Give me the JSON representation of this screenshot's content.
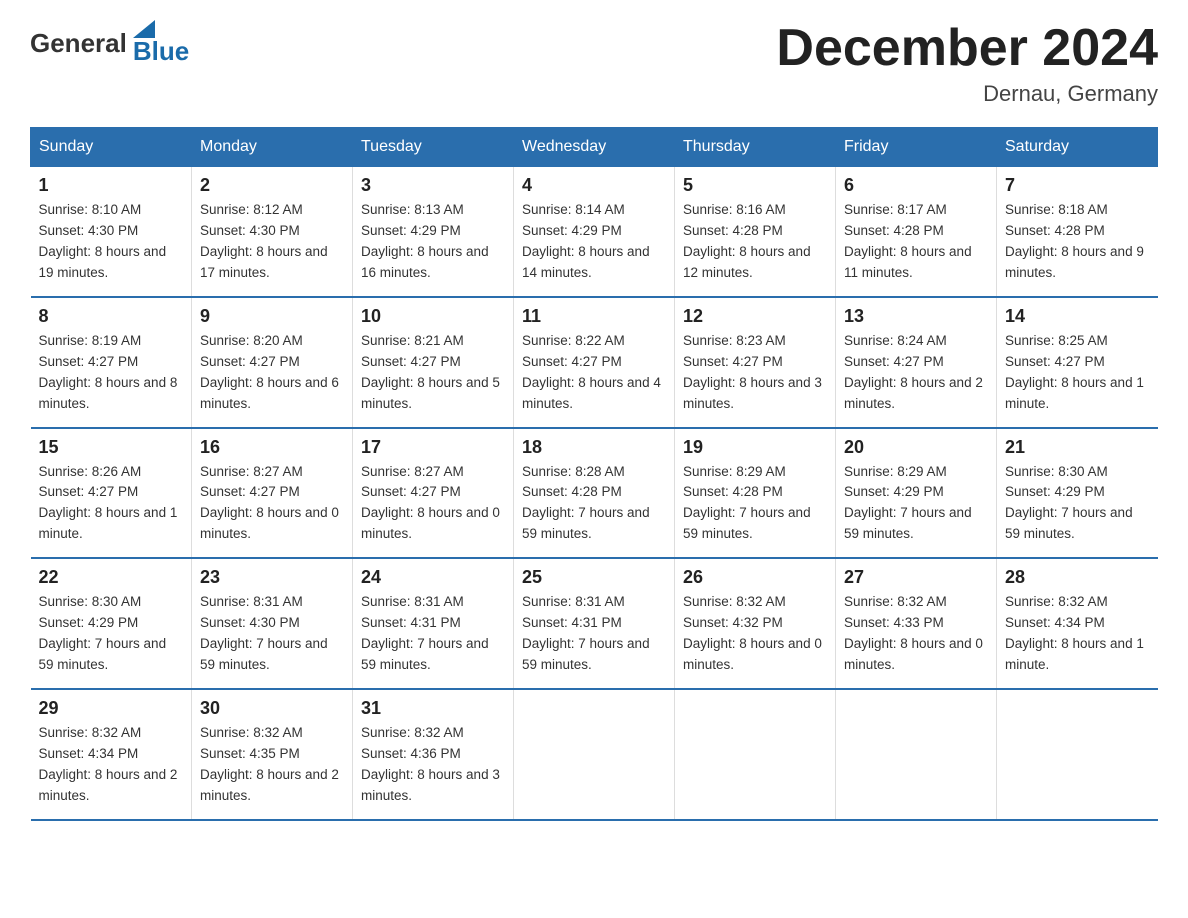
{
  "header": {
    "logo_general": "General",
    "logo_blue": "Blue",
    "month_year": "December 2024",
    "location": "Dernau, Germany"
  },
  "weekdays": [
    "Sunday",
    "Monday",
    "Tuesday",
    "Wednesday",
    "Thursday",
    "Friday",
    "Saturday"
  ],
  "weeks": [
    [
      {
        "day": "1",
        "sunrise": "8:10 AM",
        "sunset": "4:30 PM",
        "daylight": "8 hours and 19 minutes."
      },
      {
        "day": "2",
        "sunrise": "8:12 AM",
        "sunset": "4:30 PM",
        "daylight": "8 hours and 17 minutes."
      },
      {
        "day": "3",
        "sunrise": "8:13 AM",
        "sunset": "4:29 PM",
        "daylight": "8 hours and 16 minutes."
      },
      {
        "day": "4",
        "sunrise": "8:14 AM",
        "sunset": "4:29 PM",
        "daylight": "8 hours and 14 minutes."
      },
      {
        "day": "5",
        "sunrise": "8:16 AM",
        "sunset": "4:28 PM",
        "daylight": "8 hours and 12 minutes."
      },
      {
        "day": "6",
        "sunrise": "8:17 AM",
        "sunset": "4:28 PM",
        "daylight": "8 hours and 11 minutes."
      },
      {
        "day": "7",
        "sunrise": "8:18 AM",
        "sunset": "4:28 PM",
        "daylight": "8 hours and 9 minutes."
      }
    ],
    [
      {
        "day": "8",
        "sunrise": "8:19 AM",
        "sunset": "4:27 PM",
        "daylight": "8 hours and 8 minutes."
      },
      {
        "day": "9",
        "sunrise": "8:20 AM",
        "sunset": "4:27 PM",
        "daylight": "8 hours and 6 minutes."
      },
      {
        "day": "10",
        "sunrise": "8:21 AM",
        "sunset": "4:27 PM",
        "daylight": "8 hours and 5 minutes."
      },
      {
        "day": "11",
        "sunrise": "8:22 AM",
        "sunset": "4:27 PM",
        "daylight": "8 hours and 4 minutes."
      },
      {
        "day": "12",
        "sunrise": "8:23 AM",
        "sunset": "4:27 PM",
        "daylight": "8 hours and 3 minutes."
      },
      {
        "day": "13",
        "sunrise": "8:24 AM",
        "sunset": "4:27 PM",
        "daylight": "8 hours and 2 minutes."
      },
      {
        "day": "14",
        "sunrise": "8:25 AM",
        "sunset": "4:27 PM",
        "daylight": "8 hours and 1 minute."
      }
    ],
    [
      {
        "day": "15",
        "sunrise": "8:26 AM",
        "sunset": "4:27 PM",
        "daylight": "8 hours and 1 minute."
      },
      {
        "day": "16",
        "sunrise": "8:27 AM",
        "sunset": "4:27 PM",
        "daylight": "8 hours and 0 minutes."
      },
      {
        "day": "17",
        "sunrise": "8:27 AM",
        "sunset": "4:27 PM",
        "daylight": "8 hours and 0 minutes."
      },
      {
        "day": "18",
        "sunrise": "8:28 AM",
        "sunset": "4:28 PM",
        "daylight": "7 hours and 59 minutes."
      },
      {
        "day": "19",
        "sunrise": "8:29 AM",
        "sunset": "4:28 PM",
        "daylight": "7 hours and 59 minutes."
      },
      {
        "day": "20",
        "sunrise": "8:29 AM",
        "sunset": "4:29 PM",
        "daylight": "7 hours and 59 minutes."
      },
      {
        "day": "21",
        "sunrise": "8:30 AM",
        "sunset": "4:29 PM",
        "daylight": "7 hours and 59 minutes."
      }
    ],
    [
      {
        "day": "22",
        "sunrise": "8:30 AM",
        "sunset": "4:29 PM",
        "daylight": "7 hours and 59 minutes."
      },
      {
        "day": "23",
        "sunrise": "8:31 AM",
        "sunset": "4:30 PM",
        "daylight": "7 hours and 59 minutes."
      },
      {
        "day": "24",
        "sunrise": "8:31 AM",
        "sunset": "4:31 PM",
        "daylight": "7 hours and 59 minutes."
      },
      {
        "day": "25",
        "sunrise": "8:31 AM",
        "sunset": "4:31 PM",
        "daylight": "7 hours and 59 minutes."
      },
      {
        "day": "26",
        "sunrise": "8:32 AM",
        "sunset": "4:32 PM",
        "daylight": "8 hours and 0 minutes."
      },
      {
        "day": "27",
        "sunrise": "8:32 AM",
        "sunset": "4:33 PM",
        "daylight": "8 hours and 0 minutes."
      },
      {
        "day": "28",
        "sunrise": "8:32 AM",
        "sunset": "4:34 PM",
        "daylight": "8 hours and 1 minute."
      }
    ],
    [
      {
        "day": "29",
        "sunrise": "8:32 AM",
        "sunset": "4:34 PM",
        "daylight": "8 hours and 2 minutes."
      },
      {
        "day": "30",
        "sunrise": "8:32 AM",
        "sunset": "4:35 PM",
        "daylight": "8 hours and 2 minutes."
      },
      {
        "day": "31",
        "sunrise": "8:32 AM",
        "sunset": "4:36 PM",
        "daylight": "8 hours and 3 minutes."
      },
      null,
      null,
      null,
      null
    ]
  ]
}
